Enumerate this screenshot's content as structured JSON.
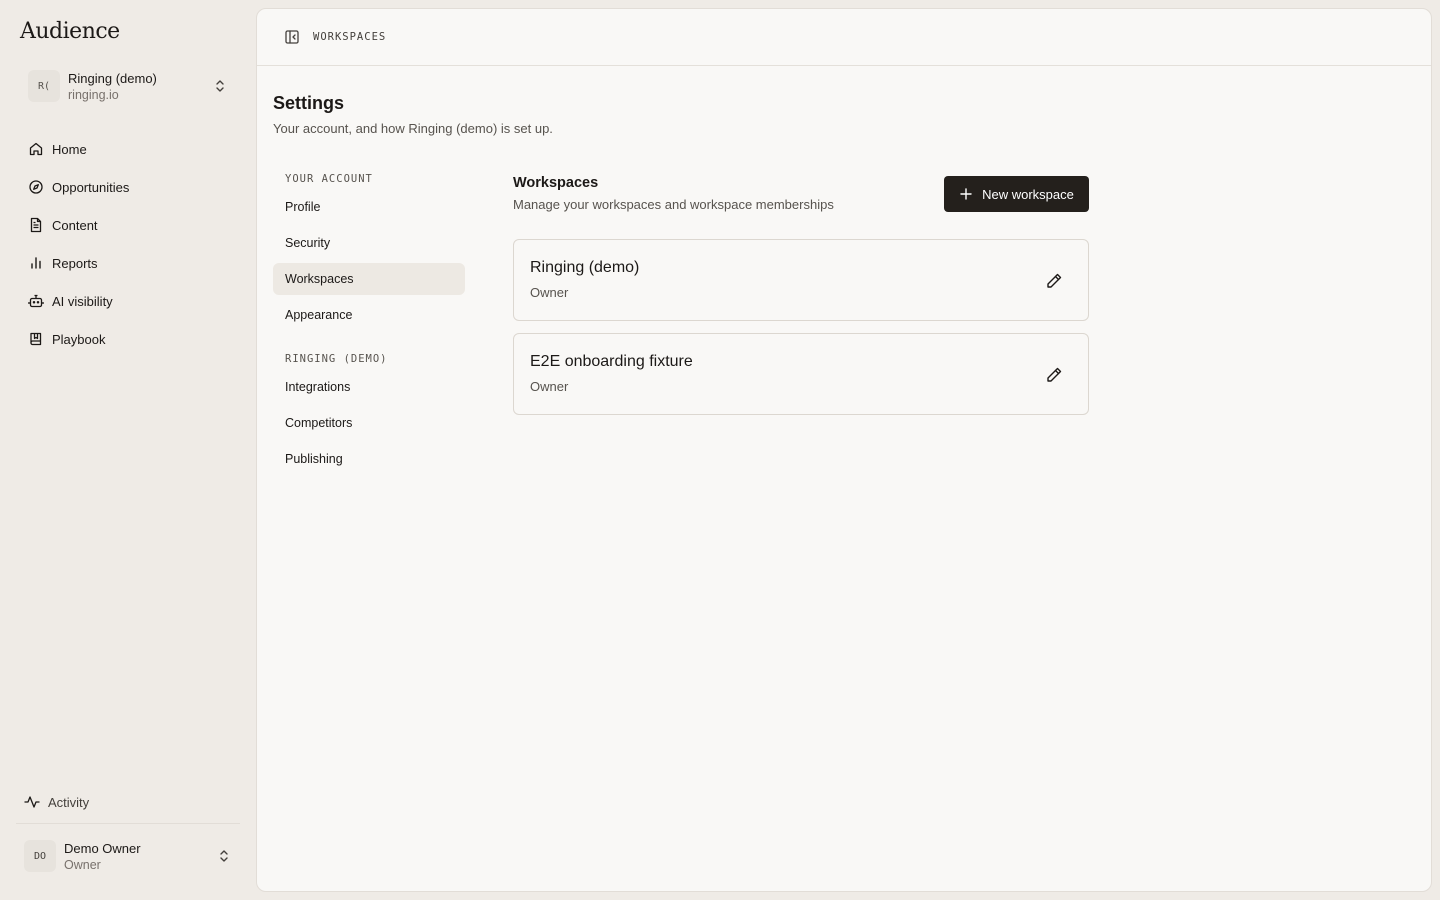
{
  "app": {
    "name": "Audience"
  },
  "workspace_switcher": {
    "initials": "R(",
    "name": "Ringing (demo)",
    "domain": "ringing.io"
  },
  "nav": {
    "items": [
      {
        "label": "Home",
        "icon": "home-icon"
      },
      {
        "label": "Opportunities",
        "icon": "compass-icon"
      },
      {
        "label": "Content",
        "icon": "document-icon"
      },
      {
        "label": "Reports",
        "icon": "bar-chart-icon"
      },
      {
        "label": "AI visibility",
        "icon": "robot-icon"
      },
      {
        "label": "Playbook",
        "icon": "book-icon"
      }
    ],
    "activity": {
      "label": "Activity",
      "icon": "activity-icon"
    }
  },
  "user": {
    "initials": "DO",
    "name": "Demo Owner",
    "role": "Owner"
  },
  "topbar": {
    "breadcrumb": "WORKSPACES"
  },
  "page": {
    "title": "Settings",
    "subtitle": "Your account, and how Ringing (demo) is set up."
  },
  "settings_nav": {
    "account_group": "YOUR ACCOUNT",
    "account_items": [
      "Profile",
      "Security",
      "Workspaces",
      "Appearance"
    ],
    "workspace_group": "RINGING (DEMO)",
    "workspace_items": [
      "Integrations",
      "Competitors",
      "Publishing"
    ],
    "active": "Workspaces"
  },
  "workspaces": {
    "title": "Workspaces",
    "subtitle": "Manage your workspaces and workspace memberships",
    "new_button": "New workspace",
    "list": [
      {
        "name": "Ringing (demo)",
        "role": "Owner"
      },
      {
        "name": "E2E onboarding fixture",
        "role": "Owner"
      }
    ]
  },
  "colors": {
    "primary_button": "#24201c",
    "background": "#efebe6",
    "panel": "#f9f8f6"
  }
}
